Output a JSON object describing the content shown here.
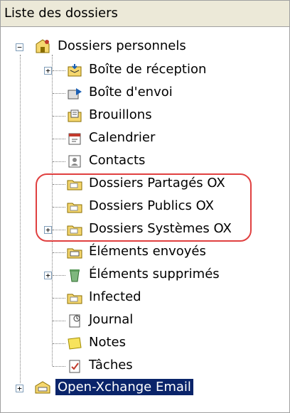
{
  "panel": {
    "title": "Liste des dossiers"
  },
  "tree": {
    "root_personal": {
      "label": "Dossiers personnels",
      "expanded": true,
      "icon": "personal-folders-icon"
    },
    "items": [
      {
        "label": "Boîte de réception",
        "icon": "inbox-icon",
        "has_children": true,
        "expanded": false
      },
      {
        "label": "Boîte d'envoi",
        "icon": "outbox-icon",
        "has_children": false
      },
      {
        "label": "Brouillons",
        "icon": "drafts-icon",
        "has_children": false
      },
      {
        "label": "Calendrier",
        "icon": "calendar-icon",
        "has_children": false
      },
      {
        "label": "Contacts",
        "icon": "contacts-icon",
        "has_children": false
      },
      {
        "label": "Dossiers Partagés OX",
        "icon": "folder-icon",
        "has_children": false
      },
      {
        "label": "Dossiers Publics OX",
        "icon": "folder-icon",
        "has_children": false
      },
      {
        "label": "Dossiers Systèmes OX",
        "icon": "folder-icon",
        "has_children": true,
        "expanded": false
      },
      {
        "label": "Éléments envoyés",
        "icon": "sent-items-icon",
        "has_children": false
      },
      {
        "label": "Éléments supprimés",
        "icon": "deleted-items-icon",
        "has_children": true,
        "expanded": false
      },
      {
        "label": "Infected",
        "icon": "folder-icon",
        "has_children": false
      },
      {
        "label": "Journal",
        "icon": "journal-icon",
        "has_children": false
      },
      {
        "label": "Notes",
        "icon": "notes-icon",
        "has_children": false
      },
      {
        "label": "Tâches",
        "icon": "tasks-icon",
        "has_children": false
      }
    ],
    "root_account": {
      "label": "Open-Xchange Email",
      "expanded": false,
      "selected": true,
      "icon": "mail-account-icon"
    }
  },
  "colors": {
    "highlight_border": "#e04040",
    "selection_bg": "#0a246a",
    "header_bg": "#ece9d8"
  }
}
